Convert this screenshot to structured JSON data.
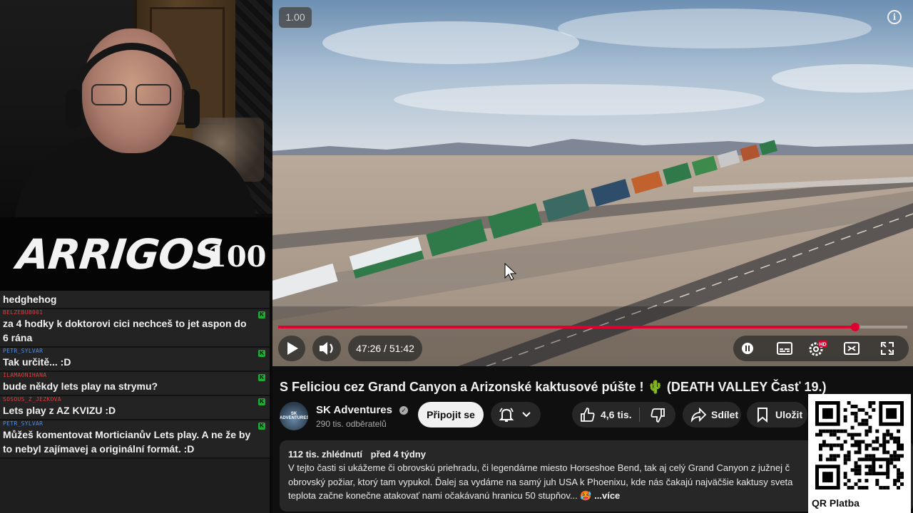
{
  "stream": {
    "logo_text": "ARRIGOS",
    "logo_count": "100"
  },
  "chat": {
    "messages": [
      {
        "user": "",
        "text": "hedghehog",
        "color": "#ffffff",
        "badge": false
      },
      {
        "user": "BELZEBUB001",
        "text": "za 4 hodky k doktorovi cici nechceš to jet aspon do 6 rána",
        "color": "#e03b3b",
        "badge": true
      },
      {
        "user": "PETR_SYLVAR",
        "text": "Tak určitě... :D",
        "color": "#4f8fe6",
        "badge": true
      },
      {
        "user": "ILAMAONIHANA",
        "text": "bude někdy lets play na strymu?",
        "color": "#e03b3b",
        "badge": true
      },
      {
        "user": "SOSOUS_Z_JEZKOVA",
        "text": "Lets play z AZ KVIZU :D",
        "color": "#e03b3b",
        "badge": true
      },
      {
        "user": "PETR_SYLVAR",
        "text": "Můžeš komentovat Morticianův Lets play. A ne že by to nebyl zajímavej a originální formát. :D",
        "color": "#4f8fe6",
        "badge": true
      }
    ]
  },
  "player": {
    "speed": "1.00",
    "time": "47:26 / 51:42",
    "progress_fraction": 0.9174,
    "accent": "#e0002f"
  },
  "video": {
    "title": "S Feliciou cez Grand Canyon a Arizonské kaktusové púšte ! 🌵 (DEATH VALLEY Časť 19.)",
    "channel": "SK Adventures",
    "avatar_text": "SK ADVENTURES",
    "subscribers": "290 tis. odběratelů",
    "join_label": "Připojit se",
    "likes": "4,6 tis.",
    "share_label": "Sdílet",
    "save_label": "Uložit",
    "views": "112 tis. zhlédnutí",
    "age": "před 4 týdny",
    "desc_lines": [
      "V tejto časti si ukážeme či obrovskú priehradu, či legendárne miesto Horseshoe Bend, tak aj celý Grand Canyon z južnej č",
      "obrovský požiar, ktorý tam vypukol. Ďalej sa vydáme na samý juh USA k Phoenixu, kde nás čakajú najväčšie kaktusy sveta",
      "teplota začne konečne atakovať nami očakávanú hranicu 50 stupňov... 🥵 "
    ],
    "more_label": "...více"
  },
  "qr": {
    "label": "QR Platba"
  },
  "icons": [
    "play-icon",
    "volume-icon",
    "pause-icon",
    "subtitles-icon",
    "settings-icon",
    "miniplayer-icon",
    "fullscreen-icon",
    "bell-icon",
    "chevron-down-icon",
    "like-icon",
    "dislike-icon",
    "share-icon",
    "save-icon",
    "info-icon",
    "verified-icon"
  ]
}
